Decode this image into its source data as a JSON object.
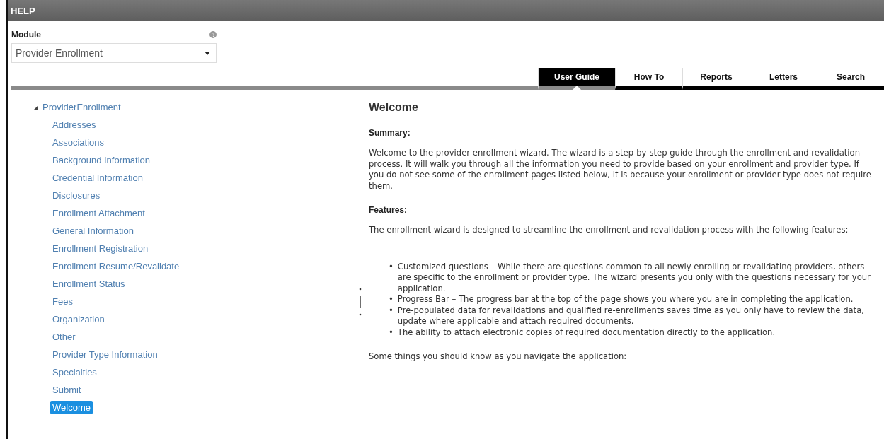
{
  "window": {
    "title": "HELP"
  },
  "module": {
    "label": "Module",
    "value": "Provider Enrollment"
  },
  "tabs": [
    {
      "label": "User Guide",
      "selected": true
    },
    {
      "label": "How To",
      "selected": false
    },
    {
      "label": "Reports",
      "selected": false
    },
    {
      "label": "Letters",
      "selected": false
    },
    {
      "label": "Search",
      "selected": false
    }
  ],
  "tree": [
    {
      "label": "ProviderEnrollment",
      "expanded": true,
      "selected": false,
      "children": [
        {
          "label": "Addresses",
          "selected": false
        },
        {
          "label": "Associations",
          "selected": false
        },
        {
          "label": "Background Information",
          "selected": false
        },
        {
          "label": "Credential Information",
          "selected": false
        },
        {
          "label": "Disclosures",
          "selected": false
        },
        {
          "label": "Enrollment Attachment",
          "selected": false
        },
        {
          "label": "General Information",
          "selected": false
        },
        {
          "label": "Enrollment Registration",
          "selected": false
        },
        {
          "label": "Enrollment Resume/Revalidate",
          "selected": false
        },
        {
          "label": "Enrollment Status",
          "selected": false
        },
        {
          "label": "Fees",
          "selected": false
        },
        {
          "label": "Organization",
          "selected": false
        },
        {
          "label": "Other",
          "selected": false
        },
        {
          "label": "Provider Type Information",
          "selected": false
        },
        {
          "label": "Specialties",
          "selected": false
        },
        {
          "label": "Submit",
          "selected": false
        },
        {
          "label": "Welcome",
          "selected": true
        }
      ]
    }
  ],
  "article": {
    "title": "Welcome",
    "blocks": [
      {
        "kind": "heading",
        "text": "Summary:"
      },
      {
        "kind": "paragraph",
        "text": "Welcome to the provider enrollment wizard. The wizard is a step-by-step guide through the enrollment and revalidation process. It will walk you through all the information you need to provide based on your enrollment and provider type. If you do not see some of the enrollment pages listed below, it is because your enrollment or provider type does not require them."
      },
      {
        "kind": "heading",
        "text": "Features:"
      },
      {
        "kind": "paragraph",
        "text": "The enrollment wizard is designed to streamline the enrollment and revalidation process with the following features:"
      },
      {
        "kind": "list",
        "items": [
          {
            "marker": "•",
            "text": "Customized questions – While there are questions common to all newly enrolling or revalidating providers, others are specific to the enrollment or provider type. The wizard presents you only with the questions necessary for your application."
          },
          {
            "marker": "•",
            "text": "Progress Bar – The progress bar at the top of the page shows you where you are in completing the application."
          },
          {
            "marker": "•",
            "text": "Pre-populated data for revalidations and qualified re-enrollments saves time as you only have to review the data, update where applicable and attach required documents."
          },
          {
            "marker": "•",
            "text": "The ability to attach electronic copies of required documentation directly to the application."
          }
        ]
      },
      {
        "kind": "paragraph",
        "text": "Some things you should know as you navigate the application:"
      }
    ]
  }
}
